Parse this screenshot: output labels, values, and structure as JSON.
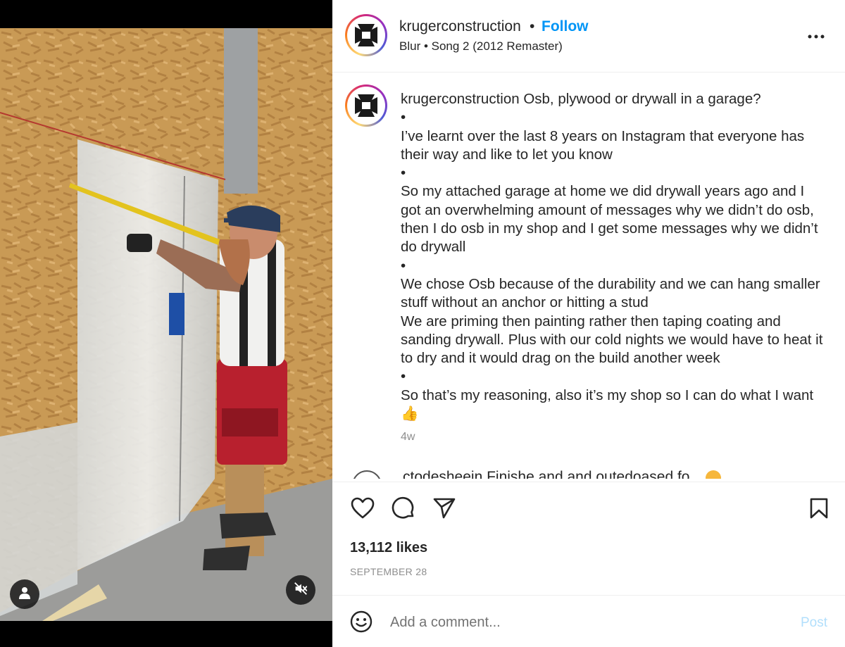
{
  "account": {
    "username": "krugerconstruction",
    "follow_label": "Follow",
    "separator": "•",
    "audio": "Blur • Song 2 (2012 Remaster)"
  },
  "caption": {
    "username": "krugerconstruction",
    "text": " Osb, plywood or drywall in a garage?\n•\nI’ve learnt over the last 8 years on Instagram that everyone has their way and like to let you know\n•\nSo my attached garage at home we did drywall years ago and I got an overwhelming amount of messages why we didn’t do osb, then I do osb in my shop and I get some messages why we didn’t do drywall\n•\nWe chose Osb because of the durability and we can hang smaller stuff without an anchor or hitting a stud\nWe are priming then painting rather then taping coating and sanding drywall. Plus with our cold nights we would have to heat it to dry and it would drag on the build another week\n•\nSo that’s my reasoning, also it’s my shop so I can do what I want",
    "emoji": "👍",
    "age": "4w"
  },
  "comment_preview": {
    "text": "ctodesheein Finishe and and outedoased fo"
  },
  "icons": {
    "more": "more-horizontal-icon",
    "like": "heart-icon",
    "comment": "speech-bubble-icon",
    "share": "paper-plane-icon",
    "save": "bookmark-icon",
    "emoji": "smiley-icon",
    "tags": "person-tag-icon",
    "mute": "speaker-muted-icon"
  },
  "stats": {
    "likes": "13,112 likes",
    "date": "SEPTEMBER 28"
  },
  "composer": {
    "placeholder": "Add a comment...",
    "post_label": "Post"
  },
  "colors": {
    "follow_blue": "#0095f6",
    "post_disabled": "#b2dffc",
    "secondary_text": "#8e8e8e"
  }
}
